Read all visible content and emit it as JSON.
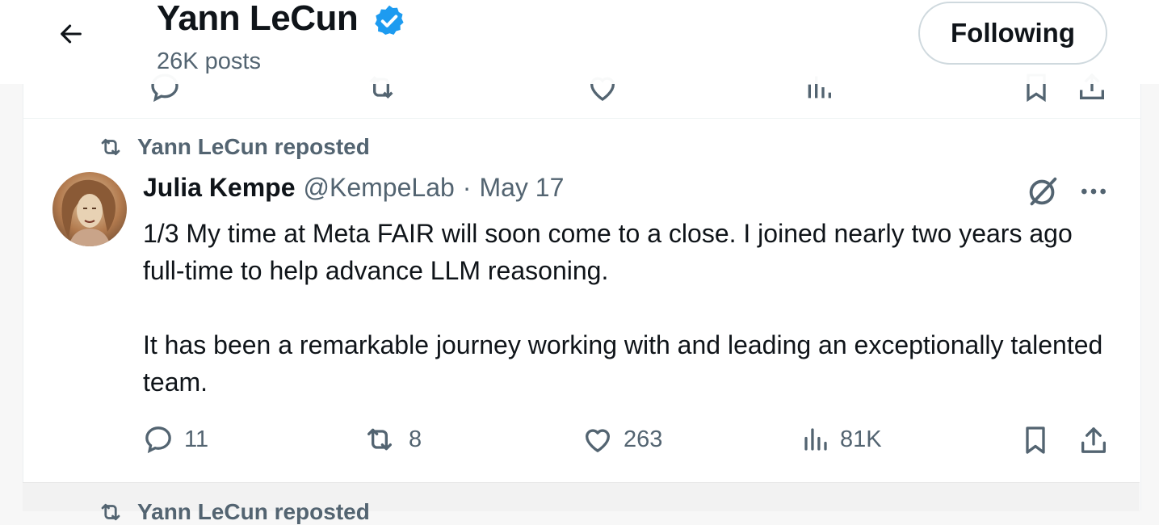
{
  "header": {
    "name": "Yann LeCun",
    "posts_count": "26K posts",
    "follow_label": "Following"
  },
  "tweet": {
    "repost_label": "Yann LeCun reposted",
    "author_name": "Julia Kempe",
    "author_handle": "@KempeLab",
    "separator": "·",
    "date": "May 17",
    "paragraphs": [
      "1/3 My time at Meta FAIR will soon come to a close. I joined nearly two years ago full-time to help advance LLM reasoning.",
      "It has been a remarkable journey working with and leading an exceptionally talented team."
    ],
    "replies": "11",
    "reposts": "8",
    "likes": "263",
    "views": "81K"
  },
  "next_tweet": {
    "repost_label": "Yann LeCun reposted"
  },
  "colors": {
    "verified": "#1d9bf0",
    "muted": "#536471",
    "text": "#0f1419"
  }
}
